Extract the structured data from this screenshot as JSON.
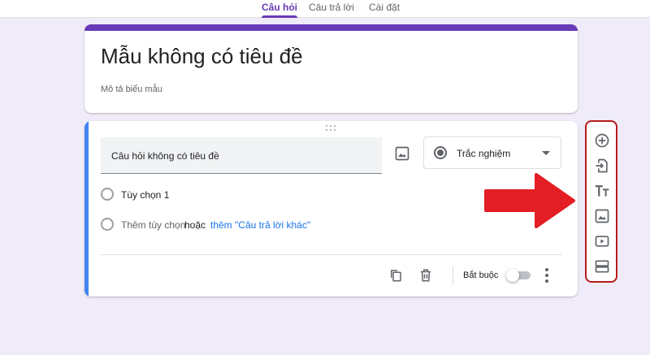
{
  "tabs": [
    {
      "label": "Câu hỏi",
      "active": true
    },
    {
      "label": "Câu trả lời",
      "active": false
    },
    {
      "label": "Cài đặt",
      "active": false
    }
  ],
  "form": {
    "title": "Mẫu không có tiêu đề",
    "description": "Mô tả biểu mẫu"
  },
  "question": {
    "title": "Câu hỏi không có tiêu đề",
    "type": "Trắc nghiệm",
    "option_1": "Tùy chọn 1",
    "add_option": "Thêm tùy chọn",
    "or": "hoặc",
    "add_other": "thêm \"Câu trả lời khác\"",
    "required_label": "Bắt buộc",
    "required": false
  },
  "toolbar_icons": [
    "add-question-icon",
    "import-questions-icon",
    "add-title-icon",
    "add-image-icon",
    "add-video-icon",
    "add-section-icon"
  ],
  "colors": {
    "accent": "#673ab7",
    "question_accent": "#4285f4",
    "background": "#f0ebf8",
    "highlight_border": "#b71c1c",
    "arrow": "#e31e24",
    "link": "#1a73e8"
  }
}
